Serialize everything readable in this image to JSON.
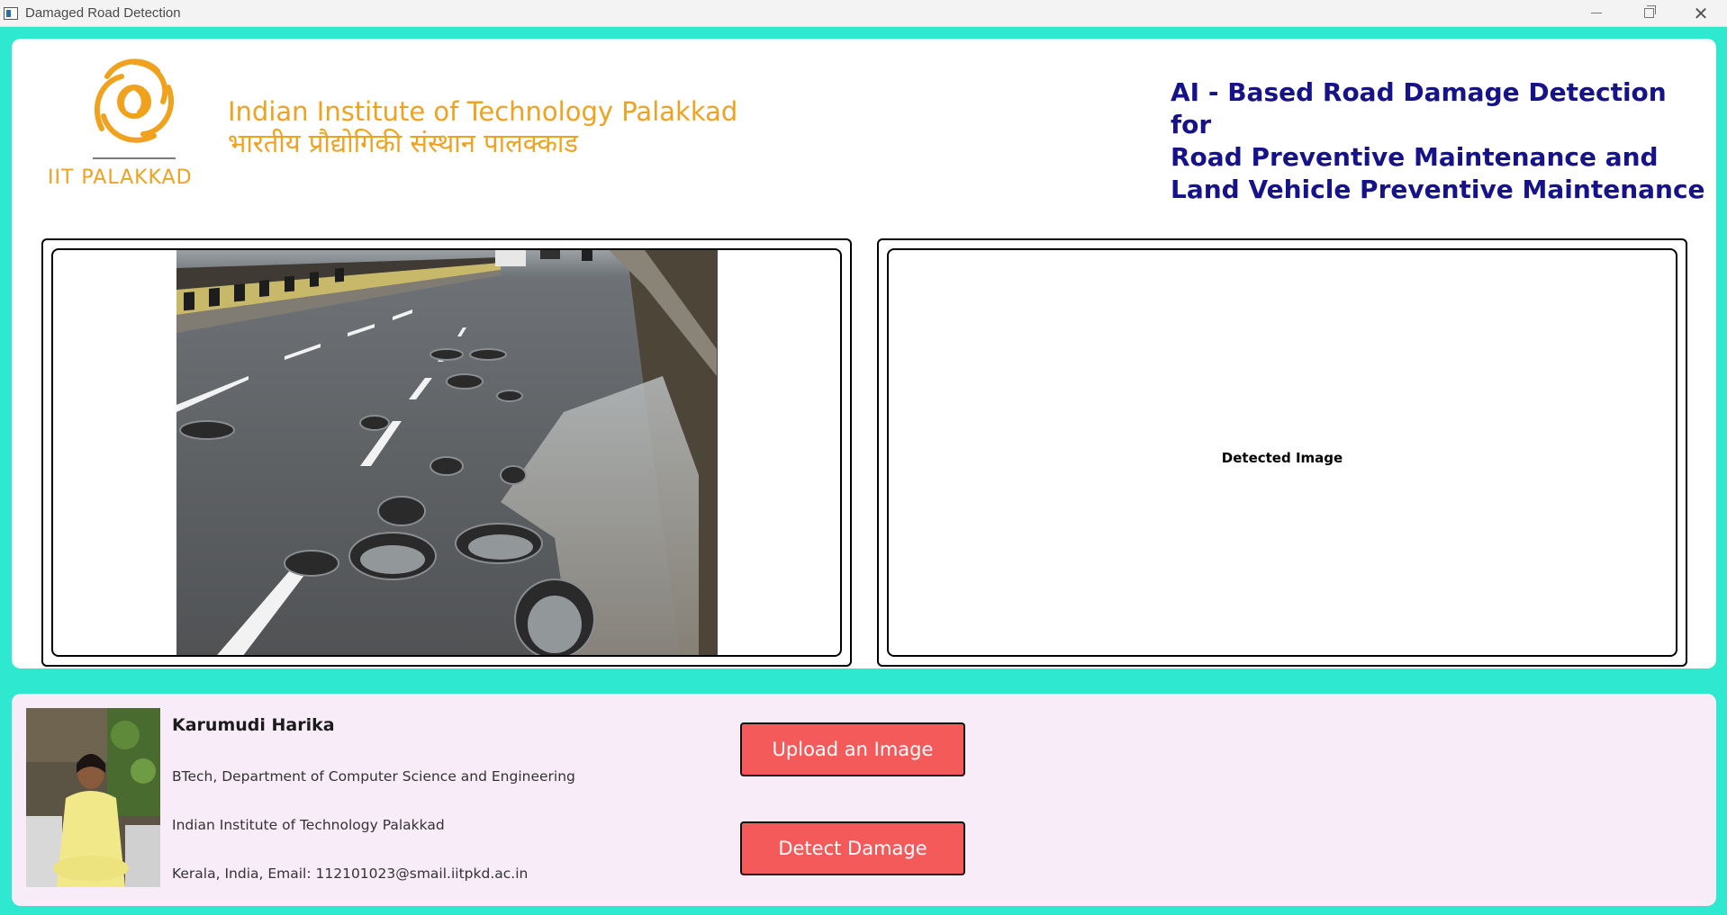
{
  "window": {
    "title": "Damaged Road Detection",
    "icon": "app-window-icon",
    "controls": [
      "minimize-icon",
      "maximize-icon",
      "close-icon"
    ]
  },
  "colors": {
    "background_accent": "#2ee8cf",
    "institute_orange": "#f0a21f",
    "title_navy": "#15128a",
    "footer_panel": "#f9ecf9",
    "button_red": "#f55a5a"
  },
  "header": {
    "logo_text": "IIT PALAKKAD",
    "institute_name_en": "Indian Institute of Technology Palakkad",
    "institute_name_hi": "भारतीय प्रौद्योगिकी संस्थान पालक्काड",
    "project_title_lines": [
      "AI - Based Road Damage Detection for",
      "Road Preventive Maintenance and",
      "Land Vehicle Preventive Maintenance"
    ]
  },
  "panels": {
    "input_image": "pothole-road-photo",
    "detected_label": "Detected Image"
  },
  "author": {
    "name": "Karumudi Harika",
    "department": "BTech, Department of Computer Science and Engineering",
    "institute": "Indian Institute of Technology Palakkad",
    "contact": "Kerala, India, Email: 112101023@smail.iitpkd.ac.in"
  },
  "actions": {
    "upload_label": "Upload an Image",
    "detect_label": "Detect Damage"
  }
}
